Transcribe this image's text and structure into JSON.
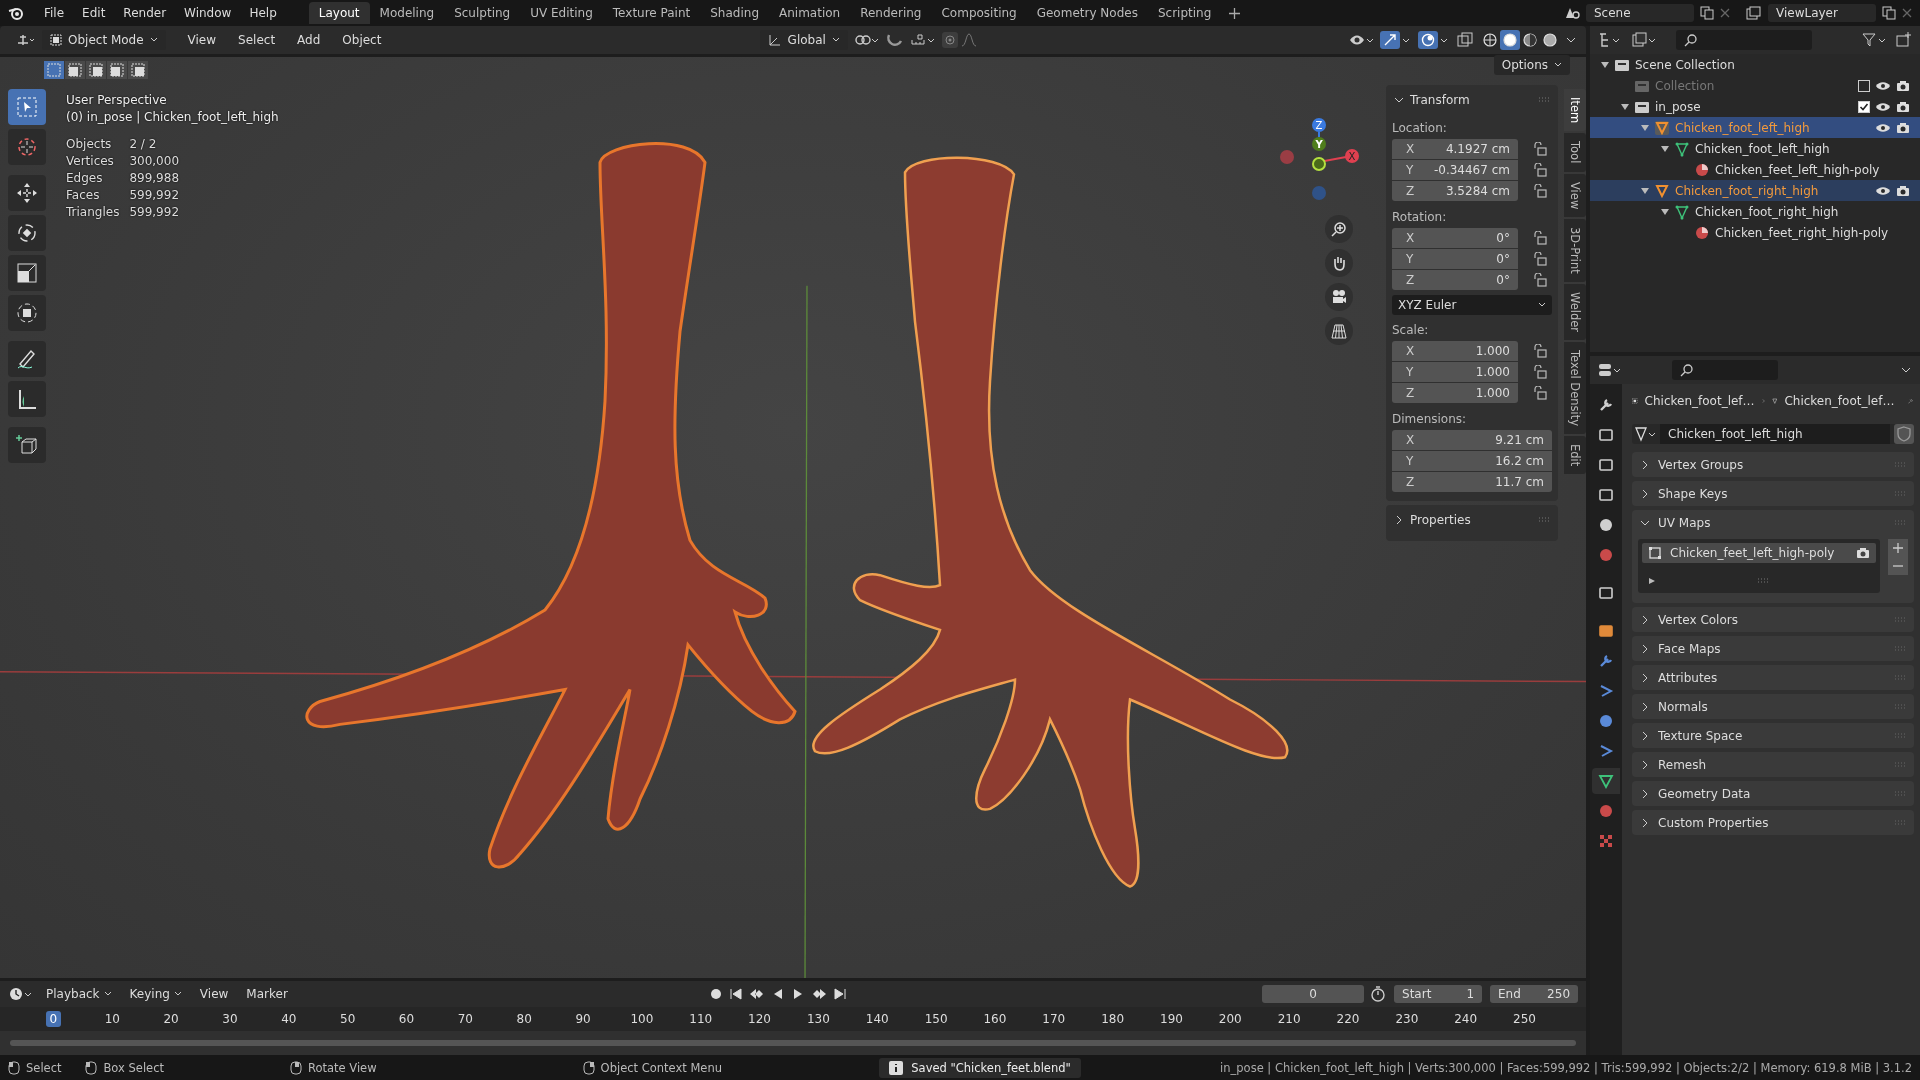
{
  "top_bar": {
    "menus": [
      "File",
      "Edit",
      "Render",
      "Window",
      "Help"
    ],
    "workspaces": [
      {
        "label": "Layout",
        "selected": true
      },
      {
        "label": "Modeling",
        "selected": false
      },
      {
        "label": "Sculpting",
        "selected": false
      },
      {
        "label": "UV Editing",
        "selected": false
      },
      {
        "label": "Texture Paint",
        "selected": false
      },
      {
        "label": "Shading",
        "selected": false
      },
      {
        "label": "Animation",
        "selected": false
      },
      {
        "label": "Rendering",
        "selected": false
      },
      {
        "label": "Compositing",
        "selected": false
      },
      {
        "label": "Geometry Nodes",
        "selected": false
      },
      {
        "label": "Scripting",
        "selected": false
      }
    ],
    "scene": "Scene",
    "view_layer": "ViewLayer"
  },
  "viewport_header": {
    "mode": "Object Mode",
    "menus": [
      "View",
      "Select",
      "Add",
      "Object"
    ],
    "orientation": "Global",
    "options": "Options",
    "select_modes": [
      {
        "selected": true
      },
      {
        "selected": false
      },
      {
        "selected": false
      },
      {
        "selected": false
      },
      {
        "selected": false
      }
    ],
    "shading": [
      {
        "kind": "wireframe",
        "selected": false
      },
      {
        "kind": "solid",
        "selected": true
      },
      {
        "kind": "material",
        "selected": false
      },
      {
        "kind": "rendered",
        "selected": false
      }
    ]
  },
  "tools": [
    {
      "kind": "select",
      "selected": true
    },
    {
      "kind": "cursor",
      "selected": false
    },
    {
      "kind": "move",
      "selected": false
    },
    {
      "kind": "rotate",
      "selected": false
    },
    {
      "kind": "scale",
      "selected": false
    },
    {
      "kind": "transform",
      "selected": false
    },
    {
      "kind": "annotate",
      "selected": false
    },
    {
      "kind": "measure",
      "selected": false
    },
    {
      "kind": "add",
      "selected": false
    }
  ],
  "viewport_overlay": {
    "view": "User Perspective",
    "context": "(0) in_pose | Chicken_foot_left_high",
    "stats": [
      {
        "label": "Objects",
        "value": "2 / 2"
      },
      {
        "label": "Vertices",
        "value": "300,000"
      },
      {
        "label": "Edges",
        "value": "899,988"
      },
      {
        "label": "Faces",
        "value": "599,992"
      },
      {
        "label": "Triangles",
        "value": "599,992"
      }
    ]
  },
  "gizmo": {
    "x": "X",
    "y": "Y",
    "z": "Z"
  },
  "sidebar": {
    "tabs": [
      {
        "label": "Item",
        "selected": true
      },
      {
        "label": "Tool",
        "selected": false
      },
      {
        "label": "View",
        "selected": false
      },
      {
        "label": "3D-Print",
        "selected": false
      },
      {
        "label": "Welder",
        "selected": false
      },
      {
        "label": "Texel Density",
        "selected": false
      },
      {
        "label": "Edit",
        "selected": false
      }
    ],
    "transform": {
      "title": "Transform",
      "expanded": true,
      "groups": [
        {
          "label": "Location:",
          "fields": [
            {
              "axis": "X",
              "value": "4.1927 cm",
              "locked": false
            },
            {
              "axis": "Y",
              "value": "-0.34467 cm",
              "locked": false
            },
            {
              "axis": "Z",
              "value": "3.5284 cm",
              "locked": false
            }
          ]
        },
        {
          "label": "Rotation:",
          "fields": [
            {
              "axis": "X",
              "value": "0°",
              "locked": false
            },
            {
              "axis": "Y",
              "value": "0°",
              "locked": false
            },
            {
              "axis": "Z",
              "value": "0°",
              "locked": false
            }
          ],
          "mode": "XYZ Euler"
        },
        {
          "label": "Scale:",
          "fields": [
            {
              "axis": "X",
              "value": "1.000",
              "locked": false
            },
            {
              "axis": "Y",
              "value": "1.000",
              "locked": false
            },
            {
              "axis": "Z",
              "value": "1.000",
              "locked": false
            }
          ]
        },
        {
          "label": "Dimensions:",
          "fields": [
            {
              "axis": "X",
              "value": "9.21 cm"
            },
            {
              "axis": "Y",
              "value": "16.2 cm"
            },
            {
              "axis": "Z",
              "value": "11.7 cm"
            }
          ]
        }
      ]
    },
    "properties": {
      "title": "Properties",
      "expanded": false
    }
  },
  "outliner": {
    "tree": [
      {
        "kind": "scene-collection",
        "name": "Scene Collection",
        "selected": false,
        "children": [
          {
            "kind": "collection",
            "name": "Collection",
            "selected": false,
            "checked": false,
            "disabled": true
          },
          {
            "kind": "collection",
            "name": "in_pose",
            "selected": false,
            "checked": true,
            "disabled": false,
            "expanded": true,
            "children": [
              {
                "kind": "object",
                "name": "Chicken_foot_left_high",
                "selected": true,
                "active": true,
                "expanded": true,
                "children": [
                  {
                    "kind": "mesh",
                    "name": "Chicken_foot_left_high",
                    "selected": false,
                    "expanded": true,
                    "children": [
                      {
                        "kind": "material",
                        "name": "Chicken_feet_left_high-poly",
                        "selected": false
                      }
                    ]
                  }
                ]
              },
              {
                "kind": "object",
                "name": "Chicken_foot_right_high",
                "selected": true,
                "active": false,
                "expanded": true,
                "children": [
                  {
                    "kind": "mesh",
                    "name": "Chicken_foot_right_high",
                    "selected": false,
                    "expanded": true,
                    "children": [
                      {
                        "kind": "material",
                        "name": "Chicken_feet_right_high-poly",
                        "selected": false
                      }
                    ]
                  }
                ]
              }
            ]
          }
        ]
      }
    ]
  },
  "properties_editor": {
    "tabs": [
      {
        "kind": "tool",
        "selected": false
      },
      {
        "kind": "render",
        "selected": false
      },
      {
        "kind": "output",
        "selected": false
      },
      {
        "kind": "view-layer",
        "selected": false
      },
      {
        "kind": "scene",
        "selected": false
      },
      {
        "kind": "world",
        "selected": false
      },
      {
        "kind": "collection",
        "selected": false
      },
      {
        "kind": "object",
        "selected": false
      },
      {
        "kind": "modifiers",
        "selected": false
      },
      {
        "kind": "particles",
        "selected": false
      },
      {
        "kind": "physics",
        "selected": false
      },
      {
        "kind": "constraints",
        "selected": false
      },
      {
        "kind": "data",
        "selected": true
      },
      {
        "kind": "material",
        "selected": false
      },
      {
        "kind": "texture",
        "selected": false
      }
    ],
    "breadcrumb": [
      "Chicken_foot_lef…",
      "Chicken_foot_lef…"
    ],
    "mesh_name": "Chicken_foot_left_high",
    "panels": [
      {
        "label": "Vertex Groups",
        "expanded": false
      },
      {
        "label": "Shape Keys",
        "expanded": false
      },
      {
        "label": "UV Maps",
        "expanded": true,
        "items": [
          {
            "name": "Chicken_feet_left_high-poly",
            "selected": true
          }
        ]
      },
      {
        "label": "Vertex Colors",
        "expanded": false
      },
      {
        "label": "Face Maps",
        "expanded": false
      },
      {
        "label": "Attributes",
        "expanded": false
      },
      {
        "label": "Normals",
        "expanded": false
      },
      {
        "label": "Texture Space",
        "expanded": false
      },
      {
        "label": "Remesh",
        "expanded": false
      },
      {
        "label": "Geometry Data",
        "expanded": false
      },
      {
        "label": "Custom Properties",
        "expanded": false
      }
    ]
  },
  "timeline": {
    "menus": [
      "Playback",
      "Keying",
      "View",
      "Marker"
    ],
    "current_frame": "0",
    "start_label": "Start",
    "start": "1",
    "end_label": "End",
    "end": "250",
    "ticks": [
      {
        "label": "0",
        "selected": true
      },
      {
        "label": "10",
        "selected": false
      },
      {
        "label": "20",
        "selected": false
      },
      {
        "label": "30",
        "selected": false
      },
      {
        "label": "40",
        "selected": false
      },
      {
        "label": "50",
        "selected": false
      },
      {
        "label": "60",
        "selected": false
      },
      {
        "label": "70",
        "selected": false
      },
      {
        "label": "80",
        "selected": false
      },
      {
        "label": "90",
        "selected": false
      },
      {
        "label": "100",
        "selected": false
      },
      {
        "label": "110",
        "selected": false
      },
      {
        "label": "120",
        "selected": false
      },
      {
        "label": "130",
        "selected": false
      },
      {
        "label": "140",
        "selected": false
      },
      {
        "label": "150",
        "selected": false
      },
      {
        "label": "160",
        "selected": false
      },
      {
        "label": "170",
        "selected": false
      },
      {
        "label": "180",
        "selected": false
      },
      {
        "label": "190",
        "selected": false
      },
      {
        "label": "200",
        "selected": false
      },
      {
        "label": "210",
        "selected": false
      },
      {
        "label": "220",
        "selected": false
      },
      {
        "label": "230",
        "selected": false
      },
      {
        "label": "240",
        "selected": false
      },
      {
        "label": "250",
        "selected": false
      }
    ]
  },
  "status_bar": {
    "hints": [
      {
        "kind": "left",
        "label": "Select"
      },
      {
        "kind": "drag",
        "label": "Box Select"
      },
      {
        "kind": "middle",
        "label": "Rotate View"
      },
      {
        "kind": "right",
        "label": "Object Context Menu"
      }
    ],
    "message": "Saved \"Chicken_feet.blend\"",
    "info": "in_pose | Chicken_foot_left_high | Verts:300,000 | Faces:599,992 | Tris:599,992 | Objects:2/2 | Memory: 619.8 MiB | 3.1.2"
  }
}
